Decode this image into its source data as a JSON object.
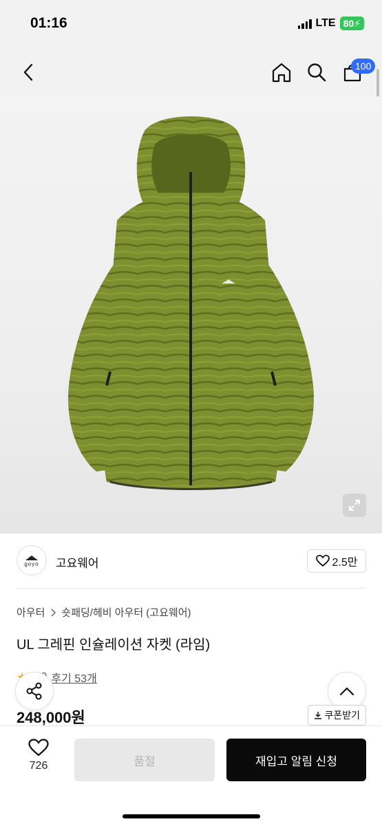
{
  "status_bar": {
    "time": "01:16",
    "network": "LTE",
    "battery": "80"
  },
  "header": {
    "cart_count": "100",
    "icons": [
      "back-icon",
      "home-icon",
      "search-icon",
      "cart-icon"
    ]
  },
  "product": {
    "image_alt_color": "#7d8f2f",
    "brand_logo_text": "goyo",
    "brand_name": "고요웨어",
    "likes": "2.5만",
    "category_root": "아우터",
    "category_sub": "숏패딩/헤비 아우터 (고요웨어)",
    "title": "UL 그레핀 인슐레이션 자켓 (라임)",
    "rating": "4.9",
    "reviews": "후기 53개",
    "price": "248,000원",
    "coupon_label": "쿠폰받기"
  },
  "bottom_bar": {
    "wish_count": "726",
    "soldout_label": "품절",
    "restock_label": "재입고 알림 신청"
  },
  "colors": {
    "accent": "#2f6bff",
    "star": "#f5a623",
    "dark_button": "#0a0a0a",
    "disabled_button": "#e8e8e8",
    "jacket": "#7d8f2f"
  }
}
